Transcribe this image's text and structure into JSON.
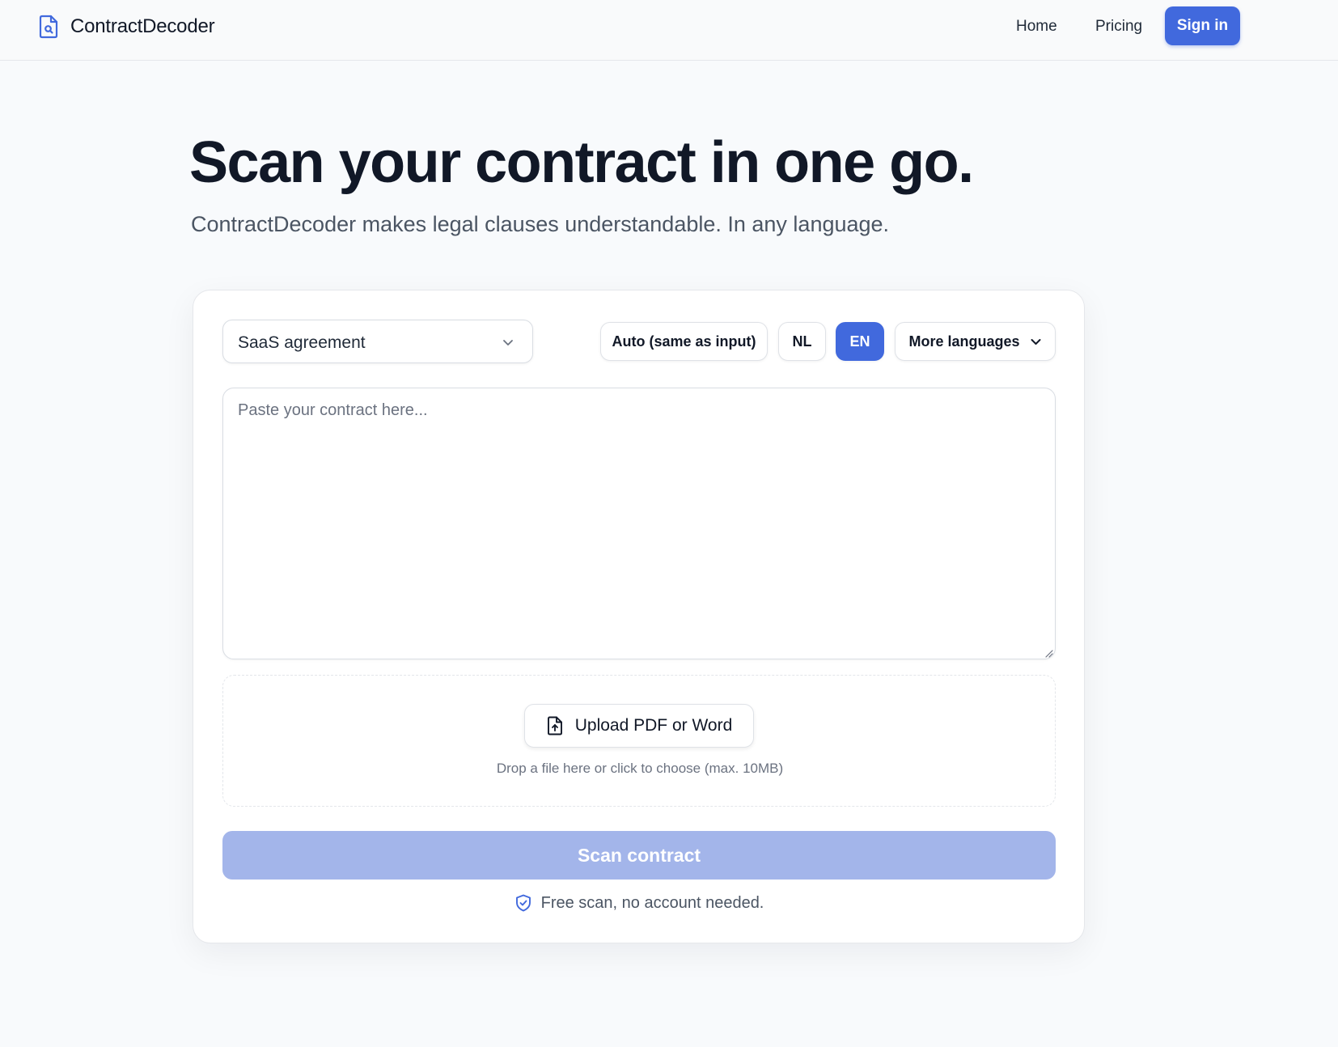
{
  "header": {
    "brand_name": "ContractDecoder",
    "nav": {
      "home": "Home",
      "pricing": "Pricing"
    },
    "signin_label": "Sign in"
  },
  "hero": {
    "title": "Scan your contract in one go.",
    "subtitle": "ContractDecoder makes legal clauses understandable. In any language."
  },
  "form": {
    "contract_type": "SaaS agreement",
    "output_languages": {
      "auto": "Auto (same as input)",
      "nl": "NL",
      "en": "EN",
      "more": "More languages",
      "selected": "EN"
    },
    "contract_placeholder": "Paste your contract here...",
    "upload": {
      "button_label": "Upload PDF or Word",
      "hint": "Drop a file here or click to choose (max. 10MB)"
    },
    "scan_label": "Scan contract",
    "free_note": "Free scan, no account needed."
  },
  "colors": {
    "accent": "#4169dd",
    "accent_disabled": "#a3b5ea",
    "text": "#111827",
    "muted": "#4b5563"
  },
  "icons": {
    "brand": "document-search-icon",
    "select": "chevron-down-icon",
    "upload": "file-upload-icon",
    "note": "shield-check-icon"
  }
}
